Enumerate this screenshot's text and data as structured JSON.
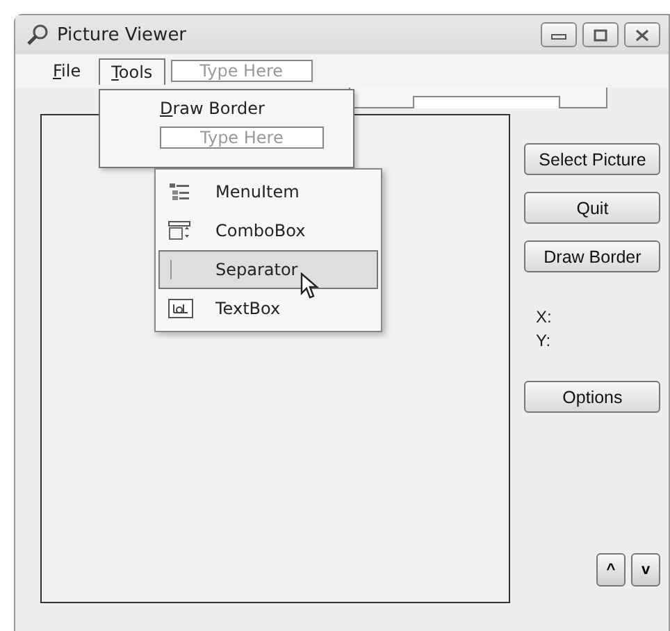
{
  "window": {
    "title": "Picture Viewer"
  },
  "menu_bar": {
    "items": [
      {
        "label": "File",
        "mnemonic": true,
        "selected": false
      },
      {
        "label": "Tools",
        "mnemonic": true,
        "selected": true
      }
    ],
    "new_item_placeholder": "Type Here"
  },
  "tools_menu": {
    "items": [
      {
        "label": "Draw Border",
        "mnemonic": true
      }
    ],
    "new_item_placeholder": "Type Here"
  },
  "add_menu": {
    "items": [
      {
        "kind": "menuitem",
        "label": "MenuItem",
        "selected": false
      },
      {
        "kind": "combobox",
        "label": "ComboBox",
        "selected": false
      },
      {
        "kind": "separator",
        "label": "Separator",
        "selected": true
      },
      {
        "kind": "textbox",
        "label": "TextBox",
        "selected": false
      }
    ]
  },
  "buttons": [
    {
      "label": "Select Picture"
    },
    {
      "label": "Quit"
    },
    {
      "label": "Draw Border"
    }
  ],
  "coords": [
    {
      "label": "X:"
    },
    {
      "label": "Y:"
    }
  ],
  "options_button": {
    "label": "Options"
  },
  "spin_buttons": [
    {
      "label": "^"
    },
    {
      "label": "v"
    }
  ]
}
